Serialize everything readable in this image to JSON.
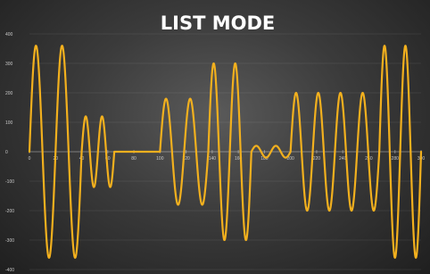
{
  "chart_data": {
    "type": "line",
    "title": "LIST MODE",
    "xlabel": "",
    "ylabel": "",
    "xlim": [
      0,
      300
    ],
    "ylim": [
      -400,
      400
    ],
    "x_ticks": [
      0,
      20,
      40,
      60,
      80,
      100,
      120,
      140,
      160,
      180,
      200,
      220,
      240,
      260,
      280,
      300
    ],
    "x_tick_labels": [
      "0",
      "20",
      "40",
      "60",
      "80",
      "100",
      "120",
      "140",
      "160",
      "180",
      "200",
      "220",
      "240",
      "260",
      "280",
      "300"
    ],
    "y_ticks": [
      -400,
      -300,
      -200,
      -100,
      0,
      100,
      200,
      300,
      400
    ],
    "y_tick_labels": [
      "-400",
      "-300",
      "-200",
      "-100",
      "0",
      "100",
      "200",
      "300",
      "400"
    ],
    "grid": true,
    "line_color": "#f2b01e",
    "series": [
      {
        "segments": [
          {
            "x_start": 0,
            "x_end": 40,
            "amplitude": 360,
            "cycles": 2
          },
          {
            "x_start": 40,
            "x_end": 65,
            "amplitude": 120,
            "cycles": 2
          },
          {
            "x_start": 65,
            "x_end": 100,
            "amplitude": 0,
            "cycles": 0
          },
          {
            "x_start": 100,
            "x_end": 137,
            "amplitude": 180,
            "cycles": 2
          },
          {
            "x_start": 137,
            "x_end": 170,
            "amplitude": 300,
            "cycles": 2
          },
          {
            "x_start": 170,
            "x_end": 200,
            "amplitude": 20,
            "cycles": 2
          },
          {
            "x_start": 200,
            "x_end": 268,
            "amplitude": 200,
            "cycles": 4
          },
          {
            "x_start": 268,
            "x_end": 300,
            "amplitude": 360,
            "cycles": 2
          }
        ]
      }
    ]
  }
}
